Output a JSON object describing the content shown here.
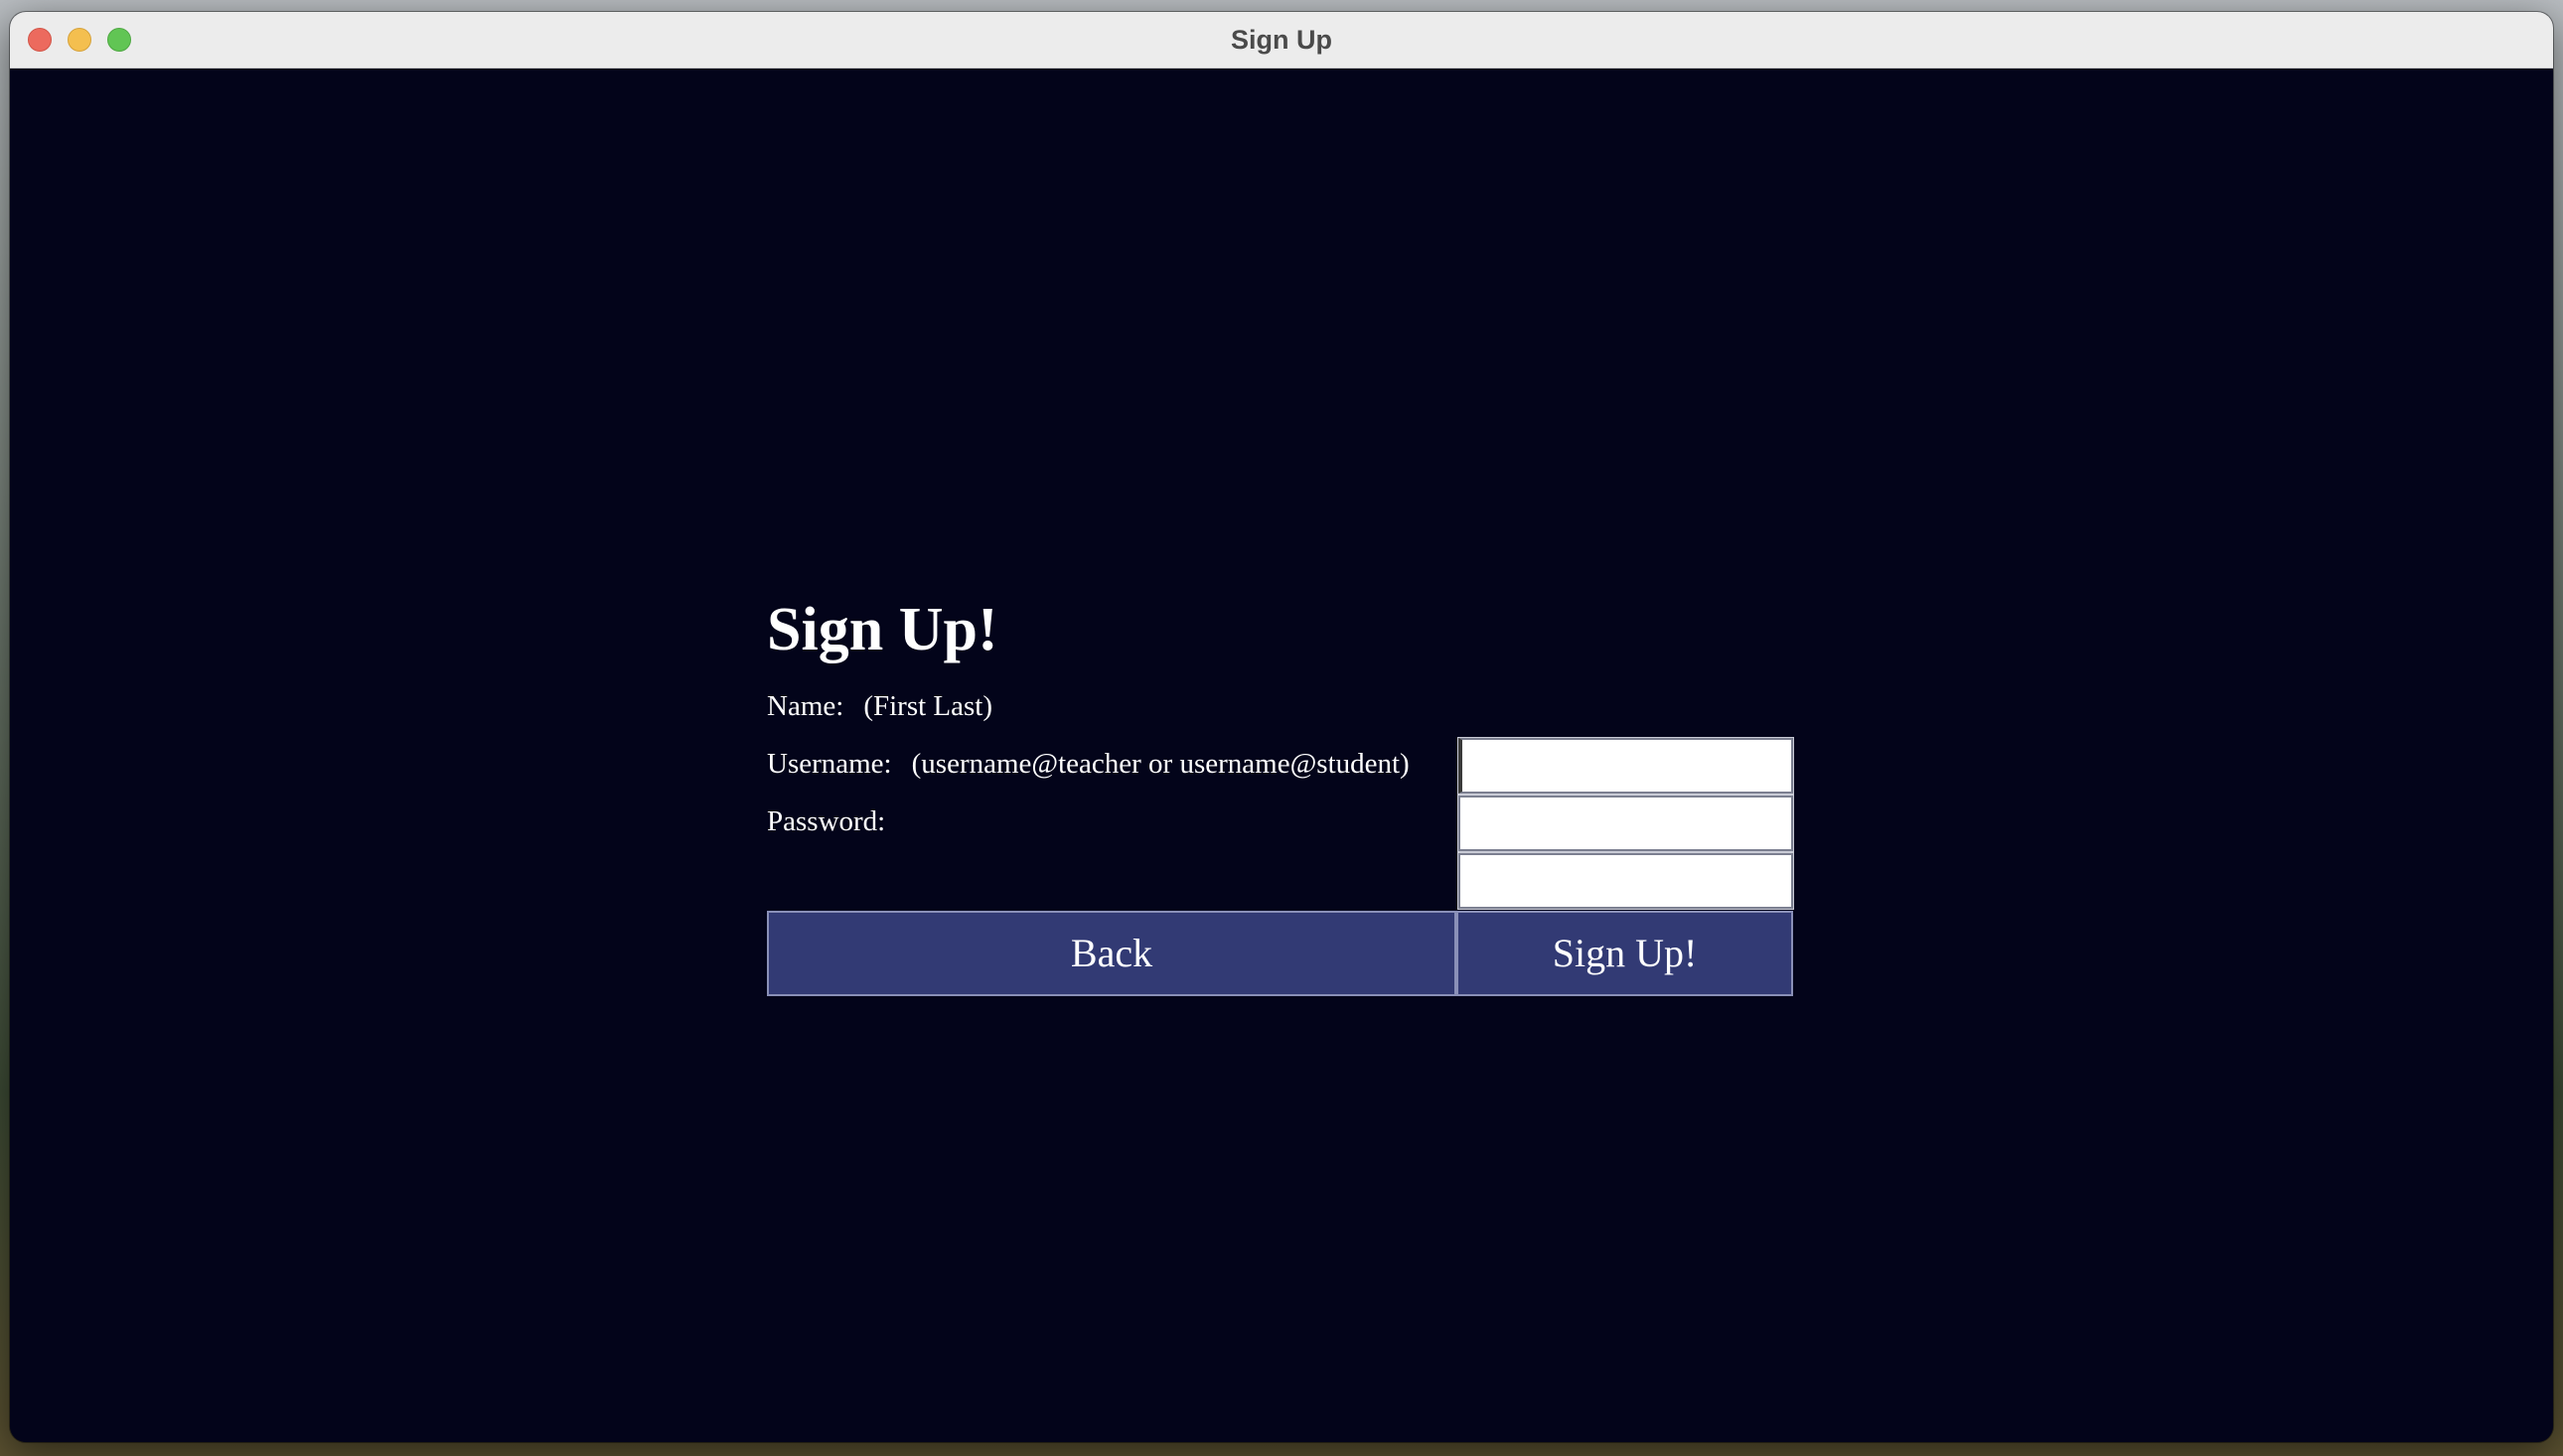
{
  "window": {
    "title": "Sign Up"
  },
  "form": {
    "heading": "Sign Up!",
    "fields": [
      {
        "label": "Name:",
        "hint": "(First Last)",
        "value": ""
      },
      {
        "label": "Username:",
        "hint": "(username@teacher or username@student)",
        "value": ""
      },
      {
        "label": "Password:",
        "hint": "",
        "value": ""
      }
    ],
    "buttons": {
      "back": "Back",
      "signup": "Sign Up!"
    }
  },
  "colors": {
    "background": "#03041a",
    "button": "#323a74",
    "text": "#ffffff"
  }
}
